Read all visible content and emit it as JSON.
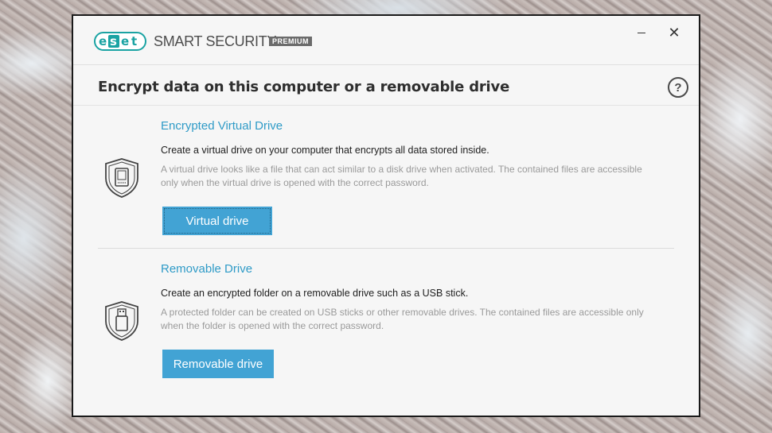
{
  "app": {
    "logo_text": "eset",
    "product_name": "SMART SECURITY",
    "edition_badge": "PREMIUM"
  },
  "window_controls": {
    "minimize_icon": "minimize-icon",
    "close_glyph": "✕"
  },
  "header": {
    "title": "Encrypt data on this computer or a removable drive",
    "help_glyph": "?"
  },
  "sections": [
    {
      "icon": "shield-virtual-drive-icon",
      "title": "Encrypted Virtual Drive",
      "description": "Create a virtual drive on your computer that encrypts all data stored inside.",
      "note": "A virtual drive looks like a file that can act similar to a disk drive when activated. The contained files are accessible only when the virtual drive is opened with the correct password.",
      "button_label": "Virtual drive"
    },
    {
      "icon": "shield-usb-icon",
      "title": "Removable Drive",
      "description": "Create an encrypted folder on a removable drive such as a USB stick.",
      "note": "A protected folder can be created on USB sticks or other removable drives. The contained files are accessible only when the folder is opened with the correct password.",
      "button_label": "Removable drive"
    }
  ],
  "colors": {
    "accent": "#2f9bc7",
    "button": "#42a3d4",
    "brand": "#1aa3a3"
  }
}
